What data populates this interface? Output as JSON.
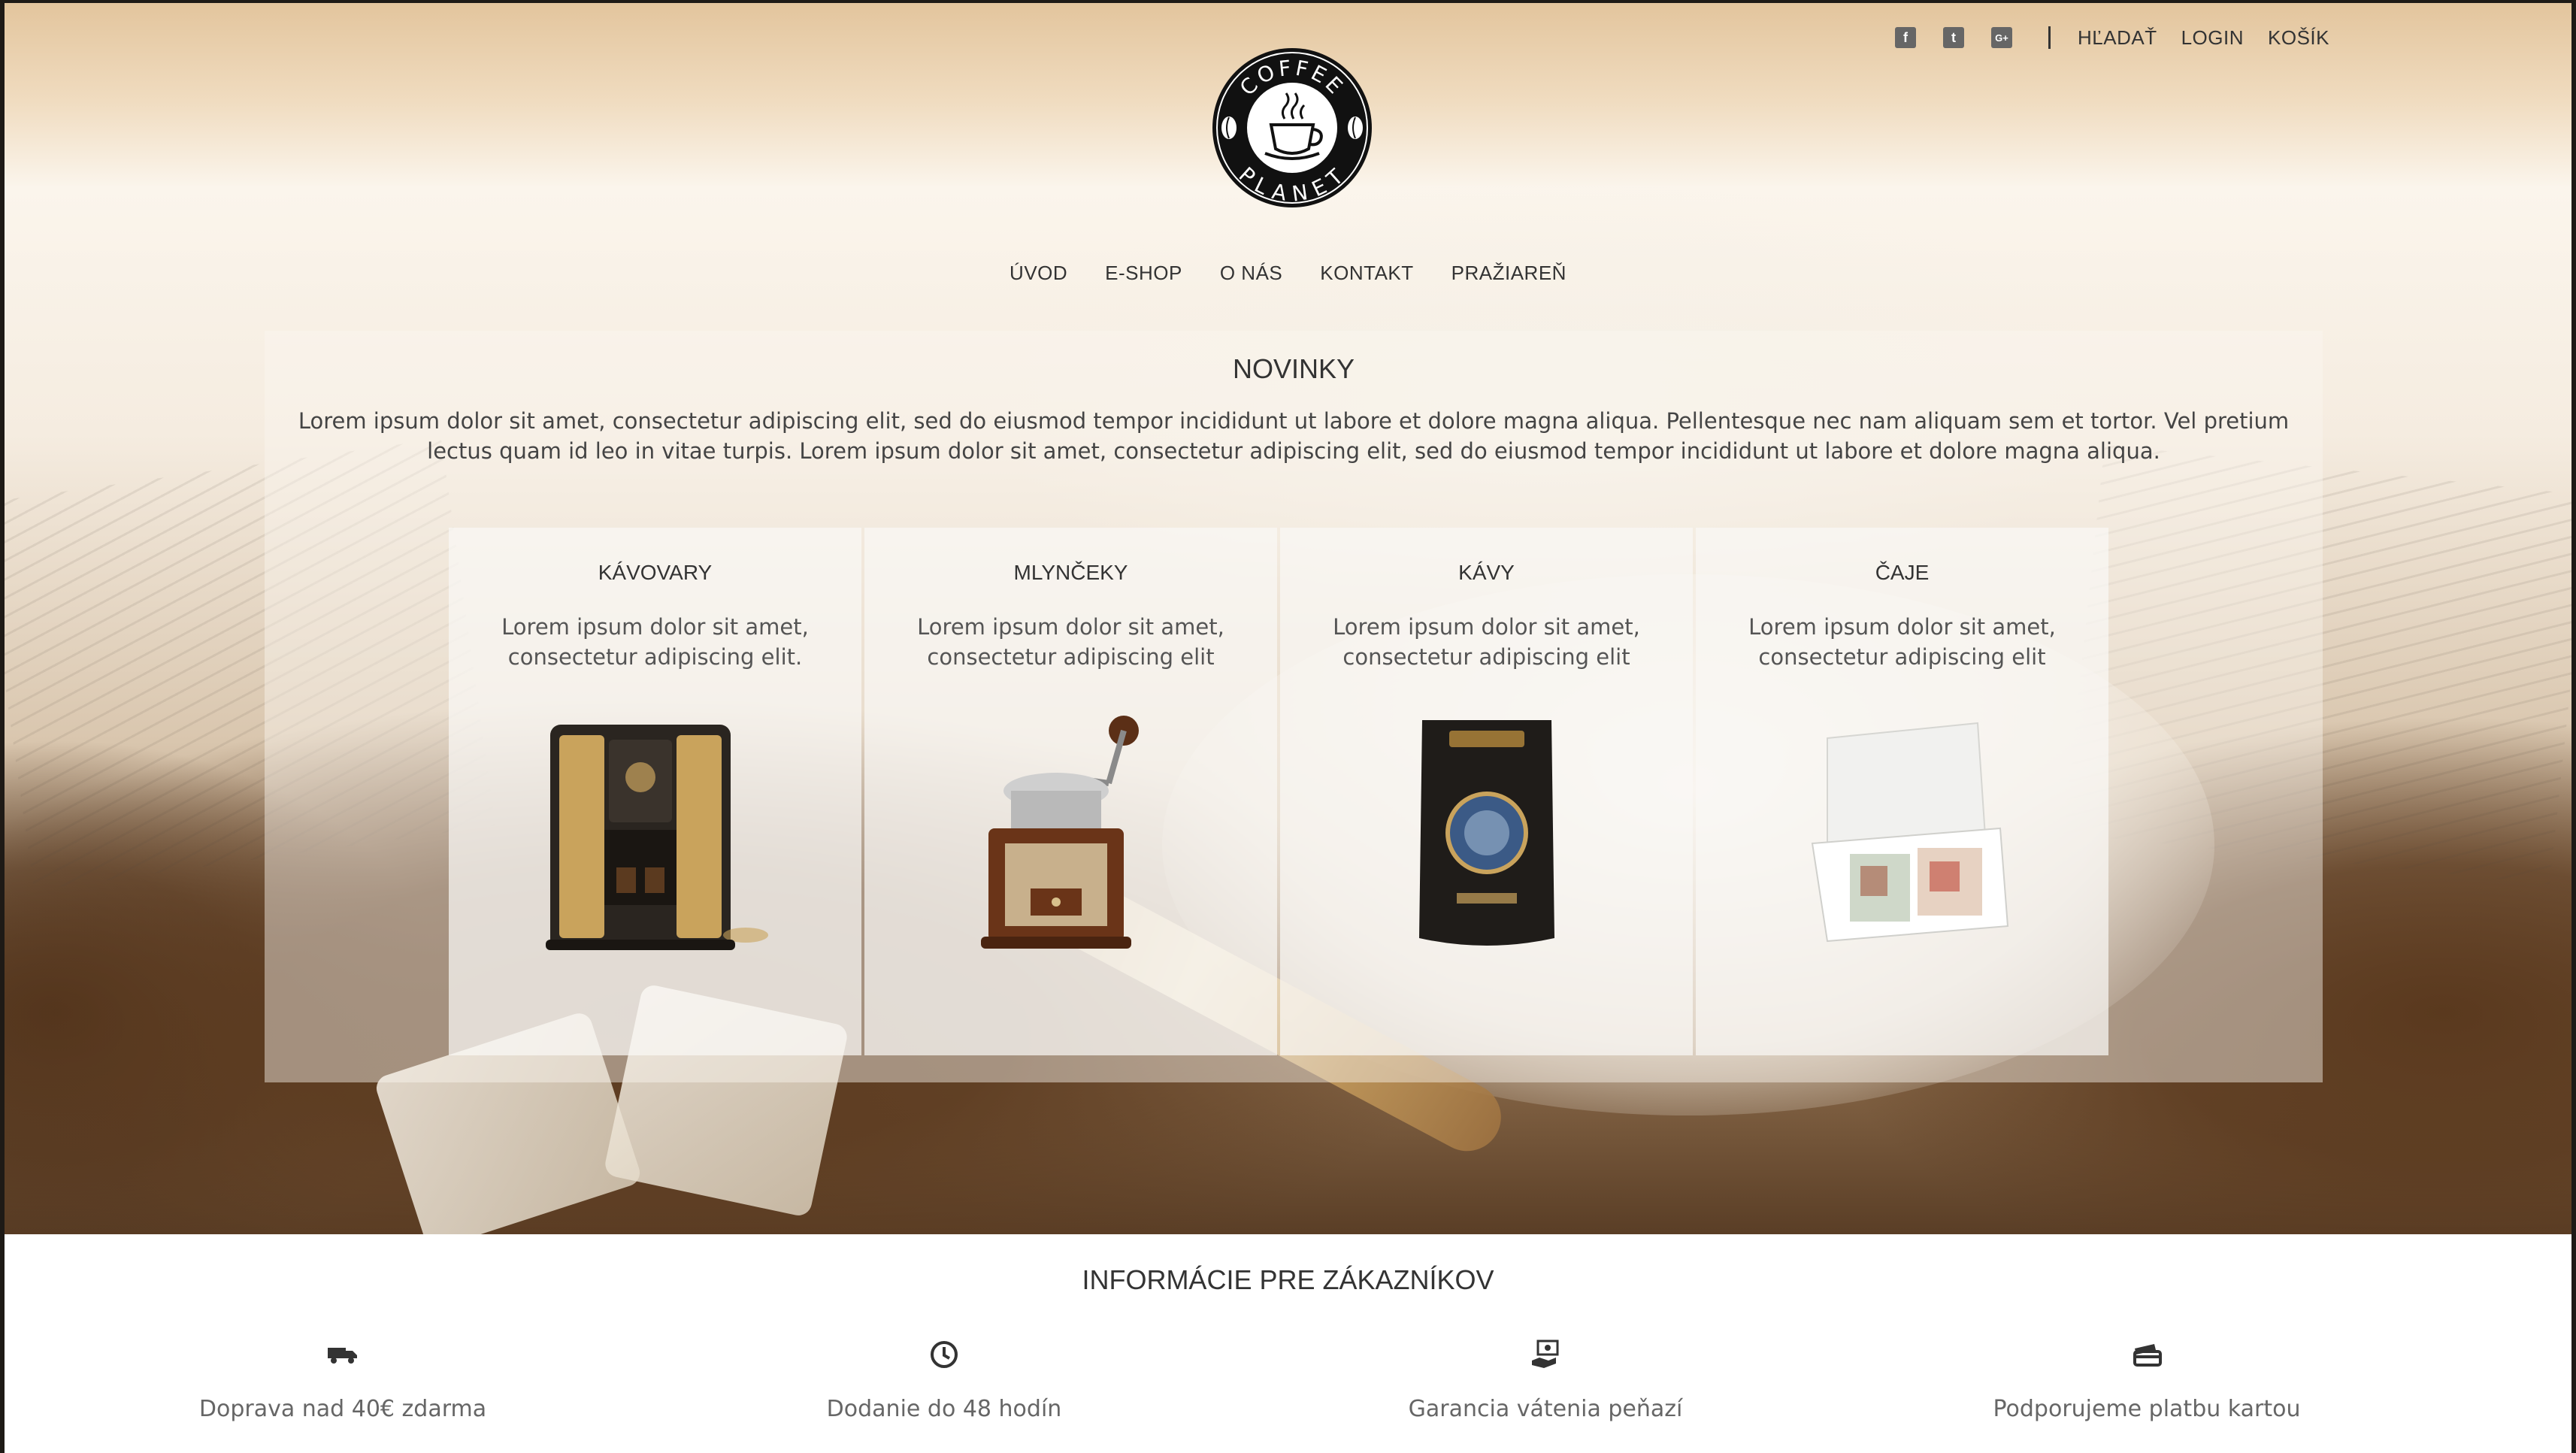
{
  "topbar": {
    "social": [
      {
        "name": "facebook-icon",
        "glyph": "f"
      },
      {
        "name": "twitter-icon",
        "glyph": "t"
      },
      {
        "name": "google-plus-icon",
        "glyph": "G+"
      }
    ],
    "links": [
      "HĽADAŤ",
      "LOGIN",
      "KOŠÍK"
    ]
  },
  "logo": {
    "top_text": "COFFEE",
    "bottom_text": "PLANET"
  },
  "nav": [
    "ÚVOD",
    "E-SHOP",
    "O NÁS",
    "KONTAKT",
    "PRAŽIAREŇ"
  ],
  "news": {
    "title": "NOVINKY",
    "text": "Lorem ipsum dolor sit amet, consectetur adipiscing elit, sed do eiusmod tempor incididunt ut labore et dolore magna aliqua. Pellentesque nec nam aliquam sem et tortor. Vel pretium lectus quam id leo in vitae turpis. Lorem ipsum dolor sit amet, consectetur adipiscing elit, sed do eiusmod tempor incididunt ut labore et dolore magna aliqua."
  },
  "cards": [
    {
      "title": "KÁVOVARY",
      "desc": "Lorem ipsum dolor sit amet, consectetur adipiscing elit.",
      "image": "coffee-machine"
    },
    {
      "title": "MLYNČEKY",
      "desc": "Lorem ipsum dolor sit amet, consectetur adipiscing elit",
      "image": "coffee-grinder"
    },
    {
      "title": "KÁVY",
      "desc": "Lorem ipsum dolor sit amet, consectetur adipiscing elit",
      "image": "coffee-bag"
    },
    {
      "title": "ČAJE",
      "desc": "Lorem ipsum dolor sit amet, consectetur adipiscing elit",
      "image": "tea-box"
    }
  ],
  "info": {
    "title": "INFORMÁCIE PRE ZÁKAZNÍKOV",
    "features": [
      {
        "icon": "truck-icon",
        "text": "Doprava nad 40€ zdarma"
      },
      {
        "icon": "clock-icon",
        "text": "Dodanie do 48 hodín"
      },
      {
        "icon": "money-hand-icon",
        "text": "Garancia vátenia peňazí"
      },
      {
        "icon": "credit-card-icon",
        "text": "Podporujeme platbu kartou"
      }
    ]
  }
}
